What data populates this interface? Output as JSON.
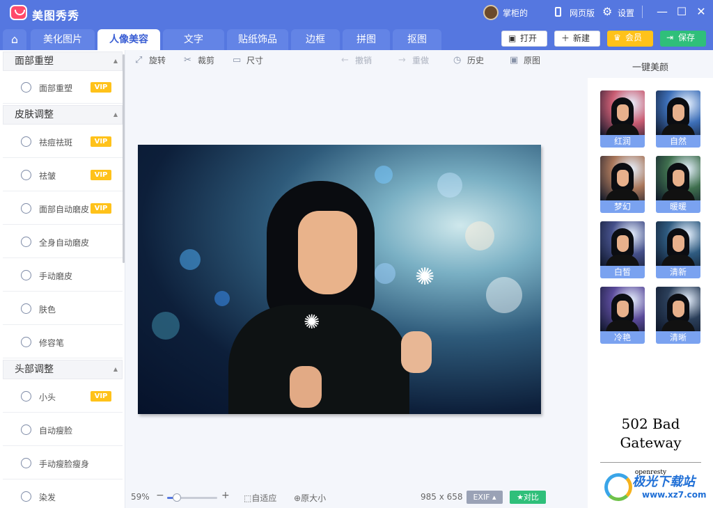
{
  "app": {
    "title": "美图秀秀"
  },
  "topbar": {
    "user_name": "掌柜的",
    "web_label": "网页版",
    "settings_label": "设置",
    "minimize": "—",
    "maximize": "☐",
    "close": "✕"
  },
  "tabs": [
    {
      "label": "美化图片"
    },
    {
      "label": "人像美容"
    },
    {
      "label": "文字"
    },
    {
      "label": "贴纸饰品"
    },
    {
      "label": "边框"
    },
    {
      "label": "拼图"
    },
    {
      "label": "抠图"
    }
  ],
  "actions": {
    "open": "打开",
    "new": "新建",
    "vip": "会员",
    "save": "保存"
  },
  "toolbar": {
    "rotate": "旋转",
    "crop": "裁剪",
    "size": "尺寸",
    "undo": "撤销",
    "redo": "重做",
    "history": "历史",
    "original": "原图"
  },
  "sidebar": {
    "vip_label": "VIP",
    "sections": [
      {
        "title": "面部重塑",
        "items": [
          {
            "label": "面部重塑",
            "vip": true
          }
        ]
      },
      {
        "title": "皮肤调整",
        "items": [
          {
            "label": "祛痘祛斑",
            "vip": true
          },
          {
            "label": "祛皱",
            "vip": true
          },
          {
            "label": "面部自动磨皮",
            "vip": true
          },
          {
            "label": "全身自动磨皮",
            "vip": false
          },
          {
            "label": "手动磨皮",
            "vip": false
          },
          {
            "label": "肤色",
            "vip": false
          },
          {
            "label": "修容笔",
            "vip": false
          }
        ]
      },
      {
        "title": "头部调整",
        "items": [
          {
            "label": "小头",
            "vip": true
          },
          {
            "label": "自动瘦脸",
            "vip": false
          },
          {
            "label": "手动瘦脸瘦身",
            "vip": false
          },
          {
            "label": "染发",
            "vip": false
          }
        ]
      }
    ]
  },
  "status": {
    "zoom": "59%",
    "zoom_fraction": 0.2,
    "fit_label": "自适应",
    "original_size_label": "原大小",
    "dimensions": "985 x 658",
    "exif_label": "EXIF",
    "compare_label": "对比"
  },
  "right_panel": {
    "title": "一键美颜",
    "presets": [
      {
        "label": "红润",
        "tint": "#c95c72"
      },
      {
        "label": "自然",
        "tint": "#3d6fb8"
      },
      {
        "label": "梦幻",
        "tint": "#a8765a"
      },
      {
        "label": "暖暖",
        "tint": "#3f6f4e"
      },
      {
        "label": "白皙",
        "tint": "#45508a"
      },
      {
        "label": "清新",
        "tint": "#2f5b80"
      },
      {
        "label": "冷艳",
        "tint": "#5a4a9a"
      },
      {
        "label": "清晰",
        "tint": "#2b3f5a"
      }
    ],
    "error_title": "502 Bad Gateway",
    "error_server": "openresty"
  },
  "watermark": {
    "name": "极光下载站",
    "url": "www.xz7.com"
  },
  "colors": {
    "brand": "#5577e0",
    "vip": "#ffc21a",
    "save": "#2fbf7a",
    "accent": "#3b5fd4"
  }
}
